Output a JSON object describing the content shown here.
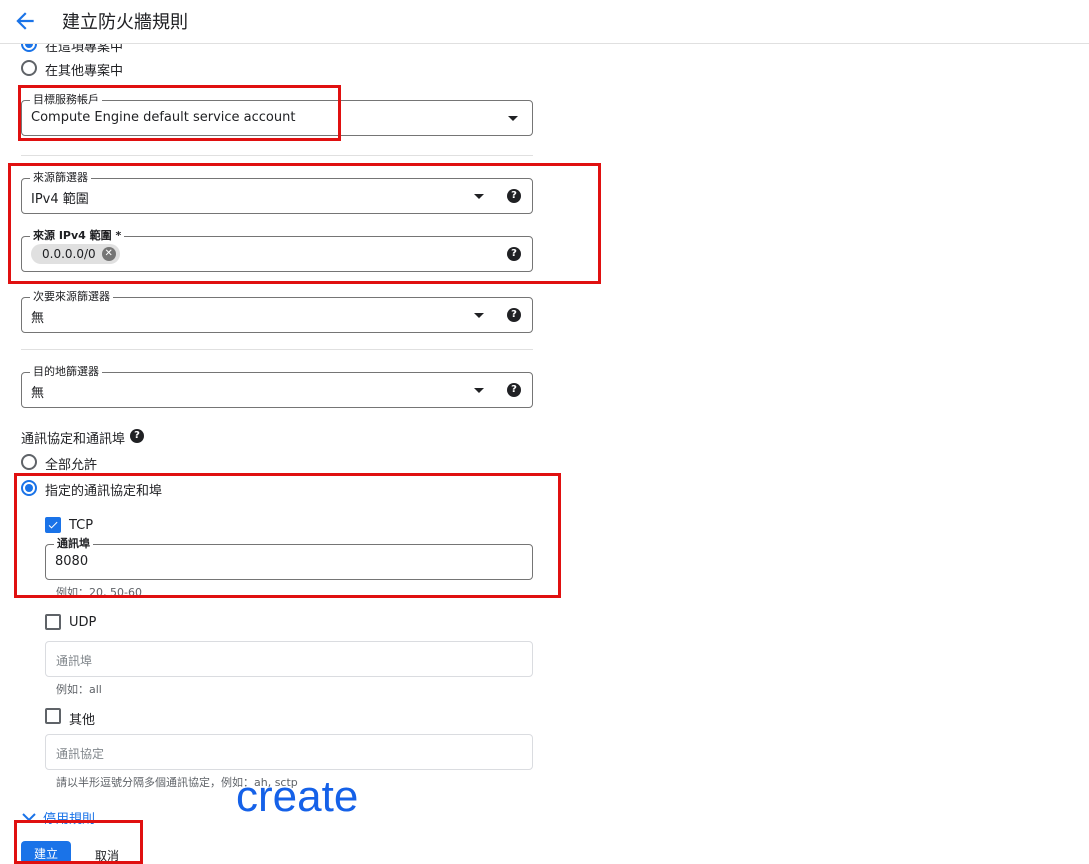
{
  "header": {
    "title": "建立防火牆規則"
  },
  "service_account_scope": {
    "options": [
      {
        "label": "在這項專案中",
        "checked": true
      },
      {
        "label": "在其他專案中",
        "checked": false
      }
    ]
  },
  "target_service_account": {
    "label": "目標服務帳戶",
    "value": "Compute Engine default service account"
  },
  "source_filter": {
    "label": "來源篩選器",
    "value": "IPv4 範圍"
  },
  "source_ipv4_ranges": {
    "label": "來源 IPv4 範圍 *",
    "chip": "0.0.0.0/0"
  },
  "second_source_filter": {
    "label": "次要來源篩選器",
    "value": "無"
  },
  "destination_filter": {
    "label": "目的地篩選器",
    "value": "無"
  },
  "protocols": {
    "title": "通訊協定和通訊埠",
    "allow_all": {
      "label": "全部允許",
      "checked": false
    },
    "specified": {
      "label": "指定的通訊協定和埠",
      "checked": true
    },
    "tcp": {
      "label": "TCP",
      "checked": true,
      "ports_label": "通訊埠",
      "ports_value": "8080",
      "hint": "例如：20, 50-60"
    },
    "udp": {
      "label": "UDP",
      "checked": false,
      "ports_placeholder": "通訊埠",
      "hint": "例如：all"
    },
    "other": {
      "label": "其他",
      "checked": false,
      "placeholder": "通訊協定",
      "hint": "請以半形逗號分隔多個通訊協定，例如：ah, sctp"
    }
  },
  "disable_rule": {
    "label": "停用規則"
  },
  "actions": {
    "create": "建立",
    "cancel": "取消"
  },
  "overlay": {
    "text": "create"
  },
  "colors": {
    "accent": "#1a73e8",
    "annotation": "#e01010",
    "overlay_text": "#1561e8"
  }
}
